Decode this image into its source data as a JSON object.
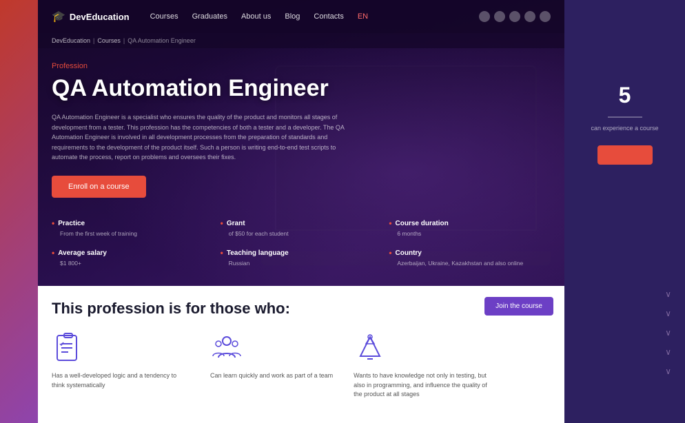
{
  "bg": {
    "right_number": "5",
    "right_text": "can experience a course"
  },
  "navbar": {
    "logo_text": "DevEducation",
    "links": [
      {
        "label": "Courses"
      },
      {
        "label": "Graduates"
      },
      {
        "label": "About us"
      },
      {
        "label": "Blog"
      },
      {
        "label": "Contacts"
      },
      {
        "label": "EN"
      }
    ]
  },
  "breadcrumb": {
    "items": [
      "DevEducation",
      "Courses",
      "QA Automation Engineer"
    ]
  },
  "hero": {
    "profession_label": "Profession",
    "title": "QA Automation Engineer",
    "description": "QA Automation Engineer is a specialist who ensures the quality of the product and monitors all stages of development from a tester. This profession has the competencies of both a tester and a developer. The QA Automation Engineer is involved in all development processes from the preparation of standards and requirements to the development of the product itself. Such a person is writing end-to-end test scripts to automate the process, report on problems and oversees their fixes.",
    "enroll_label": "Enroll on a course",
    "features": [
      {
        "title": "Practice",
        "value": "From the first week of training"
      },
      {
        "title": "Grant",
        "value": "of $50 for each student"
      },
      {
        "title": "Course duration",
        "value": "6 months"
      },
      {
        "title": "Average salary",
        "value": "$1 800+"
      },
      {
        "title": "Teaching language",
        "value": "Russian"
      },
      {
        "title": "Country",
        "value": "Azerbaijan, Ukraine, Kazakhstan and also online"
      }
    ]
  },
  "white_section": {
    "title": "This profession is for those who:",
    "join_label": "Join the course",
    "cards": [
      {
        "text": "Has a well-developed logic and a tendency to think systematically"
      },
      {
        "text": "Can learn quickly and work as part of a team"
      },
      {
        "text": "Wants to have knowledge not only in testing, but also in programming, and influence the quality of the product at all stages"
      }
    ]
  },
  "right_panel": {
    "number": "5",
    "chevrons": [
      {
        "label": ""
      },
      {
        "label": ""
      },
      {
        "label": ""
      },
      {
        "label": ""
      },
      {
        "label": ""
      }
    ]
  }
}
